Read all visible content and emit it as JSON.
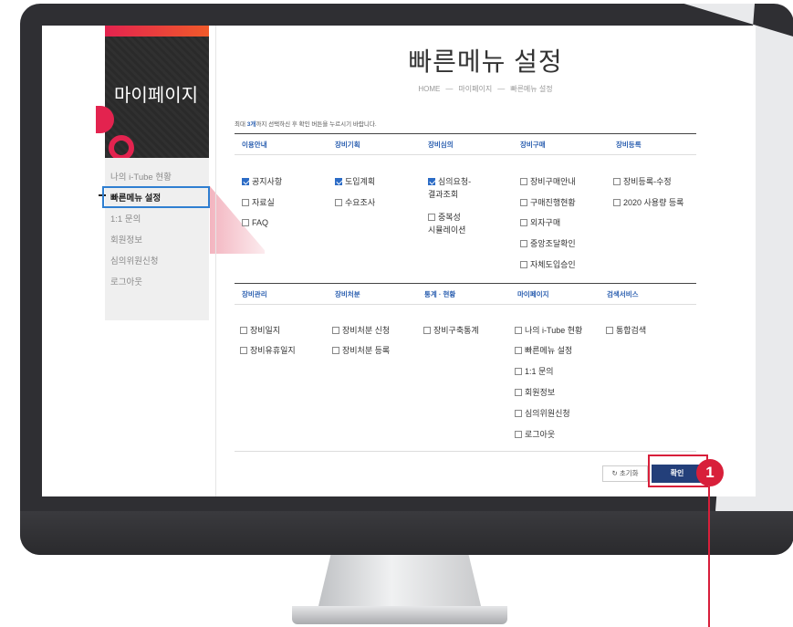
{
  "sidebar": {
    "title": "마이페이지",
    "items": [
      {
        "label": "나의 i-Tube 현황",
        "active": false
      },
      {
        "label": "빠른메뉴 설정",
        "active": true
      },
      {
        "label": "1:1 문의",
        "active": false
      },
      {
        "label": "회원정보",
        "active": false
      },
      {
        "label": "심의위원신청",
        "active": false
      },
      {
        "label": "로그아웃",
        "active": false
      }
    ]
  },
  "page": {
    "title": "빠른메뉴 설정",
    "breadcrumb": [
      "HOME",
      "마이페이지",
      "빠른메뉴 설정"
    ],
    "breadcrumb_sep": "—",
    "note_prefix": "최대 ",
    "note_bold": "3개",
    "note_suffix": "까지 선택하신 후 확인 버튼을 누르시기 바랍니다."
  },
  "groups1": {
    "headers": [
      "이용안내",
      "장비기획",
      "장비심의",
      "장비구매",
      "장비등록"
    ],
    "c1": [
      "공지사항",
      "자료실",
      "FAQ"
    ],
    "c2": [
      "도입계획",
      "수요조사"
    ],
    "c3a": [
      "심의요청-",
      "결과조회"
    ],
    "c3b": [
      "중복성",
      "시뮬레이션"
    ],
    "c4": [
      "장비구매안내",
      "구매진행현황",
      "외자구매",
      "중앙조달확인",
      "자체도입승인"
    ],
    "c5": [
      "장비등록-수정",
      "2020 사용량 등록"
    ]
  },
  "groups2": {
    "headers": [
      "장비관리",
      "장비처분",
      "통계 · 현황",
      "마이페이지",
      "검색서비스"
    ],
    "c1": [
      "장비일지",
      "장비유휴일지"
    ],
    "c2": [
      "장비처분 신청",
      "장비처분 등록"
    ],
    "c3": [
      "장비구축통계"
    ],
    "c4": [
      "나의 i-Tube 현황",
      "빠른메뉴 설정",
      "1:1 문의",
      "회원정보",
      "심의위원신청",
      "로그아웃"
    ],
    "c5": [
      "통합검색"
    ]
  },
  "checked": [
    "공지사항",
    "도입계획",
    "심의요청-결과조회"
  ],
  "buttons": {
    "reset": "↻ 초기화",
    "confirm": "확인"
  },
  "callout": {
    "number": "1"
  },
  "colors": {
    "accent": "#2b5fb0",
    "confirm_bg": "#233f7a",
    "highlight_red": "#d81f3a",
    "highlight_blue": "#2f7fd1"
  }
}
